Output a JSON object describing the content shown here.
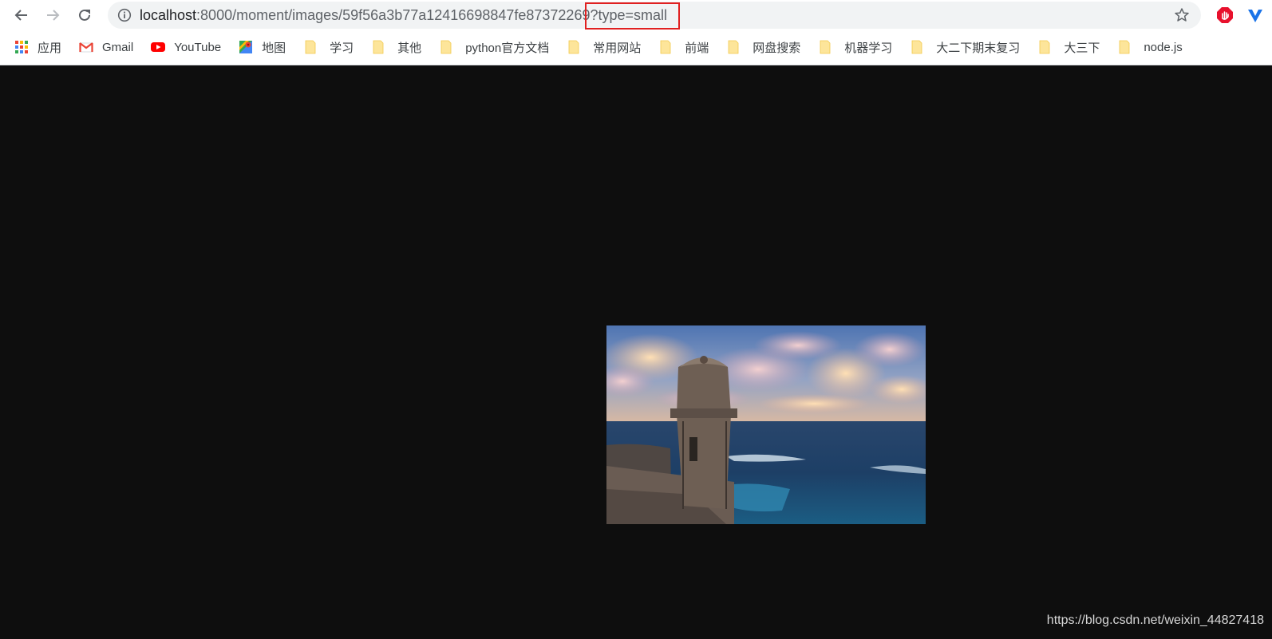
{
  "browser": {
    "url": {
      "host": "localhost",
      "path": ":8000/moment/images/59f56a3b77a12416698847fe87372269",
      "query": "?type=small"
    },
    "highlight_color": "#e02020",
    "icons": {
      "back": "arrow-left-icon",
      "forward": "arrow-right-icon",
      "reload": "reload-icon",
      "info": "info-icon",
      "bookmark_star": "star-icon",
      "extension_1": "adblock-icon",
      "extension_2": "vpn-icon"
    }
  },
  "bookmarks": [
    {
      "label": "应用",
      "icon": "apps-grid-icon"
    },
    {
      "label": "Gmail",
      "icon": "gmail-icon"
    },
    {
      "label": "YouTube",
      "icon": "youtube-icon"
    },
    {
      "label": "地图",
      "icon": "maps-icon"
    },
    {
      "label": "学习",
      "icon": "folder-icon"
    },
    {
      "label": "其他",
      "icon": "folder-icon"
    },
    {
      "label": "python官方文档",
      "icon": "folder-icon"
    },
    {
      "label": "常用网站",
      "icon": "folder-icon"
    },
    {
      "label": "前端",
      "icon": "folder-icon"
    },
    {
      "label": "网盘搜索",
      "icon": "folder-icon"
    },
    {
      "label": "机器学习",
      "icon": "folder-icon"
    },
    {
      "label": "大二下期末复习",
      "icon": "folder-icon"
    },
    {
      "label": "大三下",
      "icon": "folder-icon"
    },
    {
      "label": "node.js",
      "icon": "folder-icon"
    }
  ],
  "page": {
    "background": "#0e0e0e",
    "image": "sentry-box-over-ocean-photo",
    "watermark": "https://blog.csdn.net/weixin_44827418"
  }
}
